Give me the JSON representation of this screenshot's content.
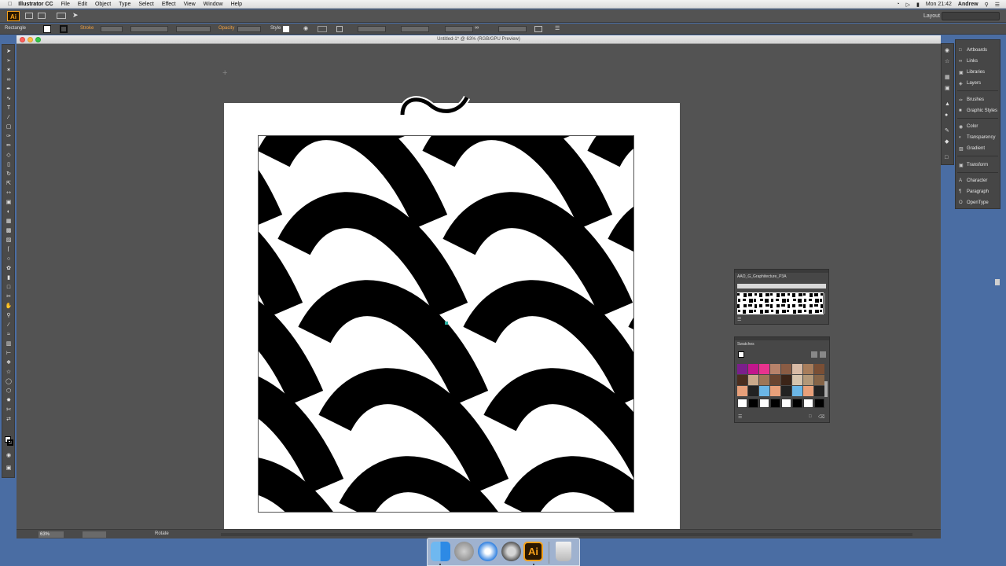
{
  "menubar": {
    "app": "Illustrator CC",
    "items": [
      "File",
      "Edit",
      "Object",
      "Type",
      "Select",
      "Effect",
      "View",
      "Window",
      "Help"
    ],
    "clock": "Mon 21:42",
    "user": "Andrew"
  },
  "appbar": {
    "logo": "Ai",
    "workspace": "Layout"
  },
  "controlbar": {
    "selection": "Rectangle",
    "stroke_label": "Stroke",
    "opacity_label": "Opacity",
    "style_label": "Style"
  },
  "document": {
    "title": "Untitled-1* @ 63% (RGB/GPU Preview)",
    "zoom": "63%",
    "status": "Rotate"
  },
  "dock_panels": [
    {
      "icon": "artboards-icon",
      "label": "Artboards"
    },
    {
      "icon": "links-icon",
      "label": "Links"
    },
    {
      "icon": "libraries-icon",
      "label": "Libraries"
    },
    {
      "icon": "layers-icon",
      "label": "Layers"
    },
    {
      "icon": "brushes-icon",
      "label": "Brushes"
    },
    {
      "icon": "graphic-styles-icon",
      "label": "Graphic Styles"
    },
    {
      "icon": "color-icon",
      "label": "Color"
    },
    {
      "icon": "transparency-icon",
      "label": "Transparency"
    },
    {
      "icon": "gradient-icon",
      "label": "Gradient"
    },
    {
      "icon": "transform-icon",
      "label": "Transform"
    },
    {
      "icon": "character-icon",
      "label": "Character"
    },
    {
      "icon": "paragraph-icon",
      "label": "Paragraph"
    },
    {
      "icon": "opentype-icon",
      "label": "OpenType"
    }
  ],
  "panels": {
    "pattern_library": "AAO_G_Graphitecture_P3A",
    "swatches": "Swatches"
  },
  "colors": {
    "swatches": [
      "#7b1f8c",
      "#c2168d",
      "#e8338e",
      "#b7826a",
      "#8a5c44",
      "#d9bba6",
      "#a87d5b",
      "#7a4f35",
      "#4b2e1f",
      "#c9a98b",
      "#9e7657",
      "#6a4530",
      "#3b2418",
      "#d7c4ad",
      "#b39878",
      "#856447"
    ]
  },
  "macdock": {
    "apps": [
      "finder-icon",
      "launchpad-icon",
      "safari-icon",
      "system-preferences-icon",
      "illustrator-icon",
      "trash-icon"
    ],
    "ai_label": "Ai"
  }
}
